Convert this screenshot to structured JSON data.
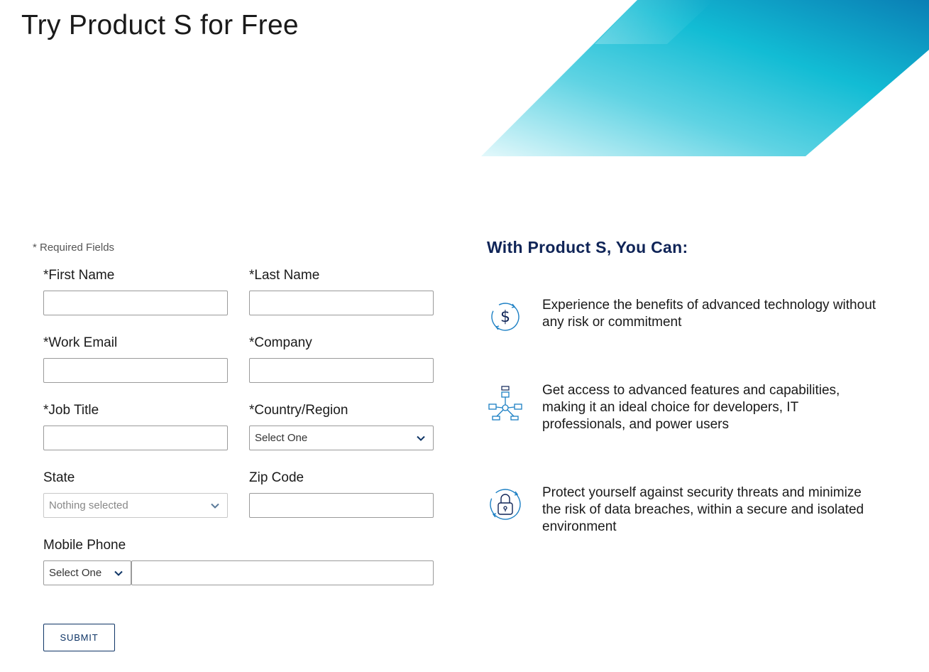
{
  "page": {
    "title": "Try Product S for Free",
    "required_note": "* Required Fields"
  },
  "form": {
    "first_name": {
      "label": "*First Name",
      "value": ""
    },
    "last_name": {
      "label": "*Last Name",
      "value": ""
    },
    "work_email": {
      "label": "*Work Email",
      "value": ""
    },
    "company": {
      "label": "*Company",
      "value": ""
    },
    "job_title": {
      "label": "*Job Title",
      "value": ""
    },
    "country": {
      "label": "*Country/Region",
      "selected": "Select One"
    },
    "state": {
      "label": "State",
      "selected": "Nothing selected",
      "disabled": true
    },
    "zip": {
      "label": "Zip Code",
      "value": ""
    },
    "mobile_phone": {
      "label": "Mobile Phone",
      "code_selected": "Select One",
      "value": ""
    },
    "submit_label": "SUBMIT"
  },
  "benefits": {
    "heading": "With Product S, You Can:",
    "items": [
      {
        "icon": "dollar-cycle-icon",
        "text": "Experience the benefits of advanced technology without any risk or commitment"
      },
      {
        "icon": "network-nodes-icon",
        "text": "Get access to advanced features and capabilities, making it an ideal choice for developers, IT professionals, and power users"
      },
      {
        "icon": "lock-cycle-icon",
        "text": "Protect yourself against security threats and minimize the risk of data breaches, within a secure and isolated environment"
      }
    ]
  },
  "colors": {
    "accent": "#0f3566",
    "heading": "#0f2457",
    "icon": "#1b7fc4",
    "banner_light": "#c8f1f7",
    "banner_mid": "#12bcd4",
    "banner_dark": "#0a7fb5"
  }
}
